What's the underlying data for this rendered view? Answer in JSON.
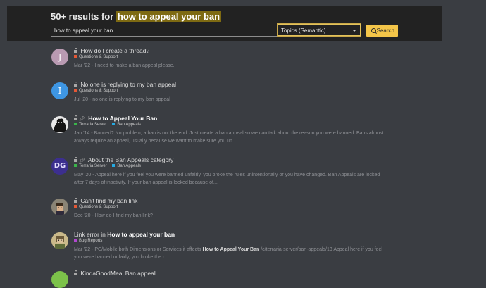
{
  "header": {
    "title_prefix": "50+ results for",
    "title_query": "how to appeal your ban",
    "search_value": "how to appeal your ban",
    "search_type": "Topics (Semantic)",
    "search_button": "Search"
  },
  "colors": {
    "questions_support": "#e45735",
    "terraria_server": "#3ab54a",
    "ban_appeals": "#25aae1",
    "bug_reports": "#b147d0",
    "accent": "#f3c549"
  },
  "results": [
    {
      "title": "How do I create a thread?",
      "avatar_letter": "J",
      "categories": [
        "Questions & Support"
      ],
      "date": "Mar '22",
      "blurb": " - I need to make a ban appeal please."
    },
    {
      "title": "No one is replying to my ban appeal",
      "avatar_letter": "I",
      "categories": [
        "Questions & Support"
      ],
      "date": "Jul '20",
      "blurb": " - no one is replying to my ban appeal"
    },
    {
      "title": "How to Appeal Your Ban",
      "categories": [
        "Terraria Server",
        "Ban Appeals"
      ],
      "date": "Jan '14",
      "blurb_line1": " - Banned? No problem, a ban is not the end. Just create a ban appeal so we can talk about the reason you were banned. Bans almost",
      "blurb_line2": "always require an appeal, usually because we want to make sure you un..."
    },
    {
      "title": "About the Ban Appeals category",
      "avatar_text": "DG",
      "categories": [
        "Terraria Server",
        "Ban Appeals"
      ],
      "date": "May '20",
      "blurb_line1": " - Appeal here if you feel you were banned unfairly, you broke the rules unintentionally or you have changed. Ban Appeals are locked",
      "blurb_line2": "after 7 days of inactivity. If your ban appeal is locked because of..."
    },
    {
      "title": "Can't find my ban link",
      "categories": [
        "Questions & Support"
      ],
      "date": "Dec '20",
      "blurb": " - How do I find my ban link?"
    },
    {
      "title_prefix": "Link error in ",
      "title_bold": "How to appeal your ban",
      "categories": [
        "Bug Reports"
      ],
      "date": "Mar '22",
      "blurb_pre": " - PC/Mobile both Dimensions or Services it affects ",
      "blurb_bold": "How to Appeal Your Ban",
      "blurb_post": " /c/terraria-server/ban-appeals/13 Appeal here if you feel",
      "blurb_line2": "you were banned unfairly, you broke the r..."
    },
    {
      "title": "KindaGoodMeal Ban appeal"
    }
  ]
}
